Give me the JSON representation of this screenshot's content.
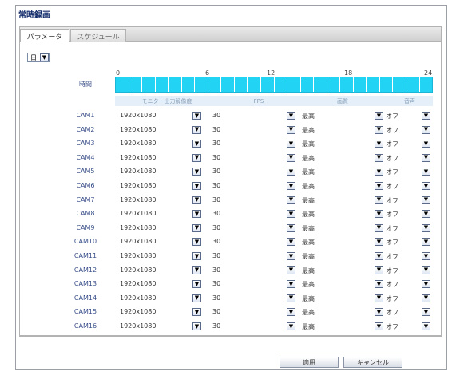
{
  "window": {
    "title": "常時録画"
  },
  "tabs": [
    {
      "label": "パラメータ",
      "active": true
    },
    {
      "label": "スケジュール",
      "active": false
    }
  ],
  "day_select": {
    "value": "日"
  },
  "time_axis": {
    "label": "時間",
    "hours": [
      "0",
      "6",
      "12",
      "18",
      "24"
    ],
    "segments": 24,
    "bar_color": "#22d3f3"
  },
  "columns": {
    "resolution": "モニター出力解像度",
    "fps": "FPS",
    "quality": "画質",
    "audio": "音声"
  },
  "cameras": [
    {
      "name": "CAM1",
      "resolution": "1920x1080",
      "fps": "30",
      "quality": "最高",
      "audio": "オフ"
    },
    {
      "name": "CAM2",
      "resolution": "1920x1080",
      "fps": "30",
      "quality": "最高",
      "audio": "オフ"
    },
    {
      "name": "CAM3",
      "resolution": "1920x1080",
      "fps": "30",
      "quality": "最高",
      "audio": "オフ"
    },
    {
      "name": "CAM4",
      "resolution": "1920x1080",
      "fps": "30",
      "quality": "最高",
      "audio": "オフ"
    },
    {
      "name": "CAM5",
      "resolution": "1920x1080",
      "fps": "30",
      "quality": "最高",
      "audio": "オフ"
    },
    {
      "name": "CAM6",
      "resolution": "1920x1080",
      "fps": "30",
      "quality": "最高",
      "audio": "オフ"
    },
    {
      "name": "CAM7",
      "resolution": "1920x1080",
      "fps": "30",
      "quality": "最高",
      "audio": "オフ"
    },
    {
      "name": "CAM8",
      "resolution": "1920x1080",
      "fps": "30",
      "quality": "最高",
      "audio": "オフ"
    },
    {
      "name": "CAM9",
      "resolution": "1920x1080",
      "fps": "30",
      "quality": "最高",
      "audio": "オフ"
    },
    {
      "name": "CAM10",
      "resolution": "1920x1080",
      "fps": "30",
      "quality": "最高",
      "audio": "オフ"
    },
    {
      "name": "CAM11",
      "resolution": "1920x1080",
      "fps": "30",
      "quality": "最高",
      "audio": "オフ"
    },
    {
      "name": "CAM12",
      "resolution": "1920x1080",
      "fps": "30",
      "quality": "最高",
      "audio": "オフ"
    },
    {
      "name": "CAM13",
      "resolution": "1920x1080",
      "fps": "30",
      "quality": "最高",
      "audio": "オフ"
    },
    {
      "name": "CAM14",
      "resolution": "1920x1080",
      "fps": "30",
      "quality": "最高",
      "audio": "オフ"
    },
    {
      "name": "CAM15",
      "resolution": "1920x1080",
      "fps": "30",
      "quality": "最高",
      "audio": "オフ"
    },
    {
      "name": "CAM16",
      "resolution": "1920x1080",
      "fps": "30",
      "quality": "最高",
      "audio": "オフ"
    }
  ],
  "buttons": {
    "apply": "適用",
    "cancel": "キャンセル"
  },
  "icons": {
    "dropdown": "chevron-down-icon"
  },
  "colors": {
    "title": "#102a6a",
    "camera_label": "#3a4f8a",
    "header_bg": "#e4eff9"
  }
}
